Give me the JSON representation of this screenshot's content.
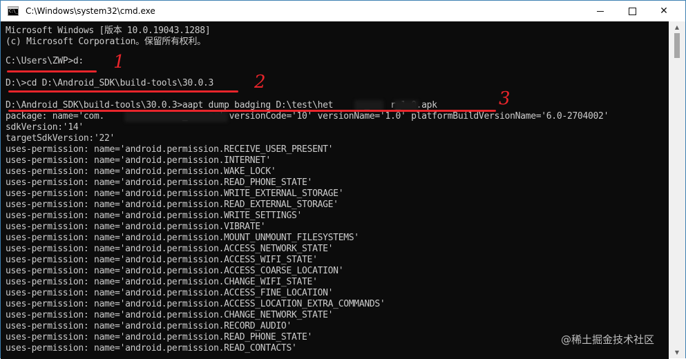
{
  "window": {
    "title": "C:\\Windows\\system32\\cmd.exe",
    "controls": {
      "minimize": "—",
      "maximize": "☐",
      "close": "✕"
    }
  },
  "console": {
    "lines": [
      "Microsoft Windows [版本 10.0.19043.1288]",
      "(c) Microsoft Corporation。保留所有权利。",
      "",
      "C:\\Users\\ZWP>d:",
      "",
      "D:\\>cd D:\\Android_SDK\\build-tools\\30.0.3",
      "",
      "D:\\Android_SDK\\build-tools\\30.0.3>aapt dump badging D:\\test\\het      _    r_1.0.apk",
      "package: name='com.               _    er' versionCode='10' versionName='1.0' platformBuildVersionName='6.0-2704002'",
      "sdkVersion:'14'",
      "targetSdkVersion:'22'",
      "uses-permission: name='android.permission.RECEIVE_USER_PRESENT'",
      "uses-permission: name='android.permission.INTERNET'",
      "uses-permission: name='android.permission.WAKE_LOCK'",
      "uses-permission: name='android.permission.READ_PHONE_STATE'",
      "uses-permission: name='android.permission.WRITE_EXTERNAL_STORAGE'",
      "uses-permission: name='android.permission.READ_EXTERNAL_STORAGE'",
      "uses-permission: name='android.permission.WRITE_SETTINGS'",
      "uses-permission: name='android.permission.VIBRATE'",
      "uses-permission: name='android.permission.MOUNT_UNMOUNT_FILESYSTEMS'",
      "uses-permission: name='android.permission.ACCESS_NETWORK_STATE'",
      "uses-permission: name='android.permission.ACCESS_WIFI_STATE'",
      "uses-permission: name='android.permission.ACCESS_COARSE_LOCATION'",
      "uses-permission: name='android.permission.CHANGE_WIFI_STATE'",
      "uses-permission: name='android.permission.ACCESS_FINE_LOCATION'",
      "uses-permission: name='android.permission.ACCESS_LOCATION_EXTRA_COMMANDS'",
      "uses-permission: name='android.permission.CHANGE_NETWORK_STATE'",
      "uses-permission: name='android.permission.RECORD_AUDIO'",
      "uses-permission: name='android.permission.READ_PHONE_STATE'",
      "uses-permission: name='android.permission.READ_CONTACTS'"
    ]
  },
  "annotations": {
    "step1": "1",
    "step2": "2",
    "step3": "3",
    "color": "#e8252b"
  },
  "watermark": "@稀土掘金技术社区",
  "colors": {
    "console_bg": "#0c0c0c",
    "console_text": "#cccccc",
    "titlebar_bg": "#ffffff"
  }
}
